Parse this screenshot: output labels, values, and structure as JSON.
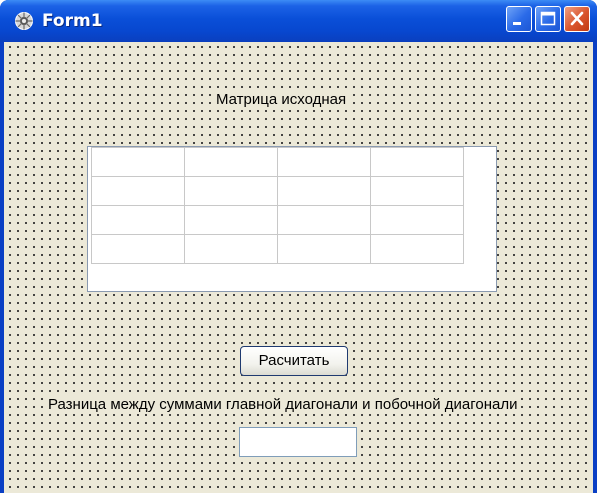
{
  "window": {
    "title": "Form1",
    "icon": "delphi-form-icon",
    "controls": [
      "minimize-icon",
      "maximize-icon",
      "close-icon"
    ]
  },
  "form": {
    "matrix_label": "Матрица исходная",
    "grid": {
      "rows": 4,
      "cols": 4,
      "cells": [
        [
          "",
          "",
          "",
          ""
        ],
        [
          "",
          "",
          "",
          ""
        ],
        [
          "",
          "",
          "",
          ""
        ],
        [
          "",
          "",
          "",
          ""
        ]
      ]
    },
    "calc_button_label": "Расчитать",
    "difference_label": "Разница между суммами главной диагонали и побочной диагонали",
    "result_value": ""
  },
  "colors": {
    "titlebar": "#0a4fd8",
    "form_background": "#ece9d8",
    "close_button": "#d9542c"
  }
}
